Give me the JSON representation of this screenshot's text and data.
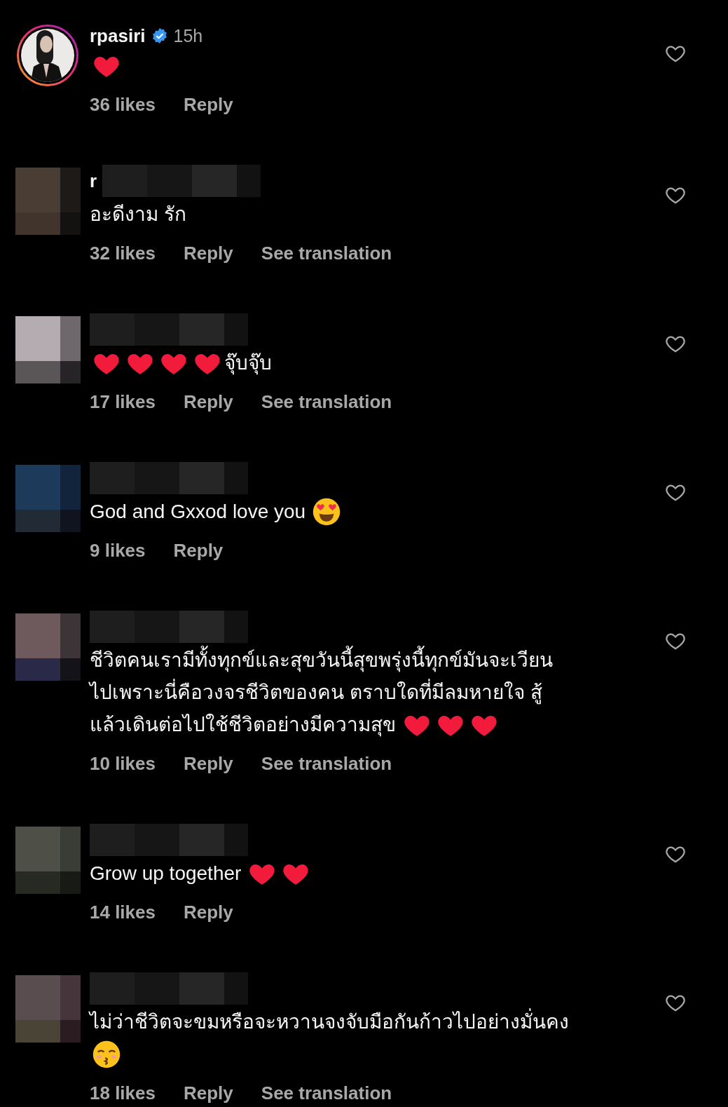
{
  "comments": [
    {
      "username": "rpasiri",
      "redacted": false,
      "verified": true,
      "time": "15h",
      "avatar": {
        "kind": "story"
      },
      "lines": [
        [
          {
            "kind": "heart"
          }
        ]
      ],
      "likes": "36 likes",
      "reply": "Reply"
    },
    {
      "username": "r",
      "redacted": true,
      "verified": false,
      "avatar": {
        "kind": "mosaic"
      },
      "lines": [
        [
          {
            "kind": "text",
            "text": "อะดีงาม รัก"
          }
        ]
      ],
      "likes": "32 likes",
      "reply": "Reply",
      "see_translation": "See translation"
    },
    {
      "redacted": true,
      "verified": false,
      "avatar": {
        "kind": "mosaic"
      },
      "lines": [
        [
          {
            "kind": "heart"
          },
          {
            "kind": "heart"
          },
          {
            "kind": "heart"
          },
          {
            "kind": "heart"
          },
          {
            "kind": "text",
            "text": "จุ๊บจุ๊บ"
          }
        ]
      ],
      "likes": "17 likes",
      "reply": "Reply",
      "see_translation": "See translation"
    },
    {
      "redacted": true,
      "verified": false,
      "avatar": {
        "kind": "mosaic"
      },
      "lines": [
        [
          {
            "kind": "text",
            "text": "God and Gxxod love you"
          },
          {
            "kind": "heart-eyes"
          }
        ]
      ],
      "likes": "9 likes",
      "reply": "Reply"
    },
    {
      "redacted": true,
      "verified": false,
      "avatar": {
        "kind": "mosaic"
      },
      "lines": [
        [
          {
            "kind": "text",
            "text": "ชีวิตคนเรามีทั้งทุกข์และสุขวันนี้สุขพรุ่งนี้ทุกข์มันจะเวียน"
          }
        ],
        [
          {
            "kind": "text",
            "text": "ไปเพราะนี่คือวงจรชีวิตของคน ตราบใดที่มีลมหายใจ สู้"
          }
        ],
        [
          {
            "kind": "text",
            "text": "แล้วเดินต่อไปใช้ชีวิตอย่างมีความสุข"
          },
          {
            "kind": "heart"
          },
          {
            "kind": "heart"
          },
          {
            "kind": "heart"
          }
        ]
      ],
      "likes": "10 likes",
      "reply": "Reply",
      "see_translation": "See translation"
    },
    {
      "redacted": true,
      "verified": false,
      "avatar": {
        "kind": "mosaic"
      },
      "lines": [
        [
          {
            "kind": "text",
            "text": "Grow up together"
          },
          {
            "kind": "heart"
          },
          {
            "kind": "heart"
          }
        ]
      ],
      "likes": "14 likes",
      "reply": "Reply"
    },
    {
      "redacted": true,
      "verified": false,
      "avatar": {
        "kind": "mosaic"
      },
      "lines": [
        [
          {
            "kind": "text",
            "text": "ไม่ว่าชีวิตจะขมหรือจะหวานจงจับมือกันก้าวไปอย่างมั่นคง"
          }
        ],
        [
          {
            "kind": "kissing"
          }
        ]
      ],
      "likes": "18 likes",
      "reply": "Reply",
      "see_translation": "See translation"
    }
  ]
}
